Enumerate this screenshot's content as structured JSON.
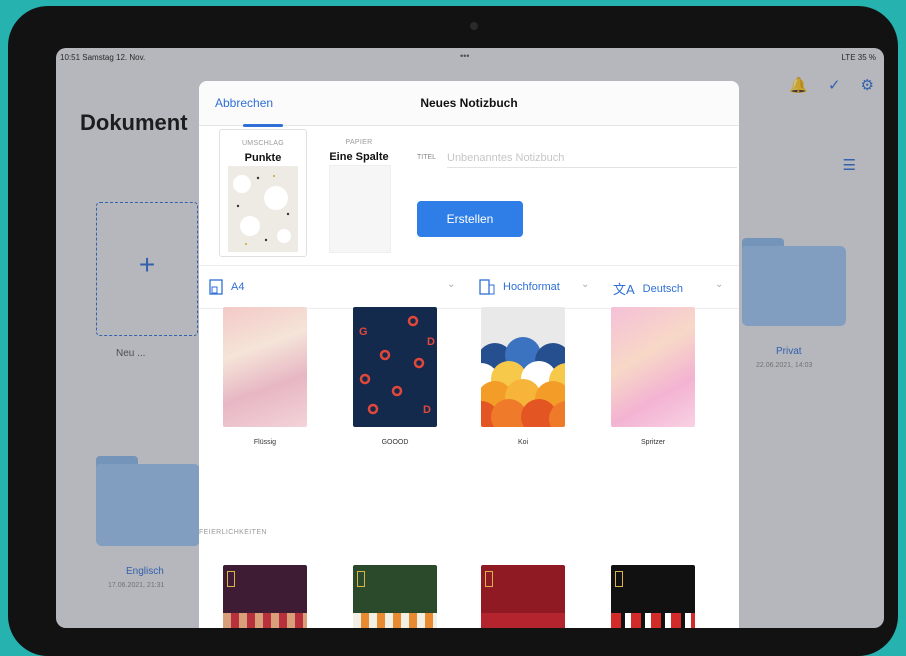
{
  "status_bar": {
    "time_date": "10:51 Samstag 12. Nov.",
    "dots": "•••",
    "right_info": "LTE 35 %"
  },
  "page": {
    "title": "Dokument",
    "new_label": "Neu ...",
    "plus": "+"
  },
  "folders": [
    {
      "name": "Privat",
      "date": "22.06.2021, 14:03"
    },
    {
      "name": "Englisch",
      "date": "17.06.2021, 21:31"
    }
  ],
  "modal": {
    "cancel_label": "Abbrechen",
    "title": "Neues Notizbuch",
    "cover": {
      "label": "UMSCHLAG",
      "value": "Punkte"
    },
    "paper": {
      "label": "PAPIER",
      "value": "Eine Spalte"
    },
    "title_field": {
      "label": "TITEL",
      "placeholder": "Unbenanntes Notizbuch",
      "value": ""
    },
    "create_label": "Erstellen",
    "options": {
      "size": "A4",
      "orientation": "Hochformat",
      "language": "Deutsch"
    },
    "covers": [
      {
        "name": "Flüssig",
        "style": "fluid"
      },
      {
        "name": "GOOOD",
        "style": "goood"
      },
      {
        "name": "Koi",
        "style": "koi"
      },
      {
        "name": "Spritzer",
        "style": "splash"
      }
    ],
    "section_festive": "FEIERLICHKEITEN",
    "festive_covers": [
      {
        "color": "#3e1c33"
      },
      {
        "color": "#2b4a2c"
      },
      {
        "color": "#8f1a24"
      },
      {
        "color": "#111111"
      }
    ]
  },
  "colors": {
    "accent": "#2f7ee8",
    "teal_bg": "#26b3b0"
  }
}
